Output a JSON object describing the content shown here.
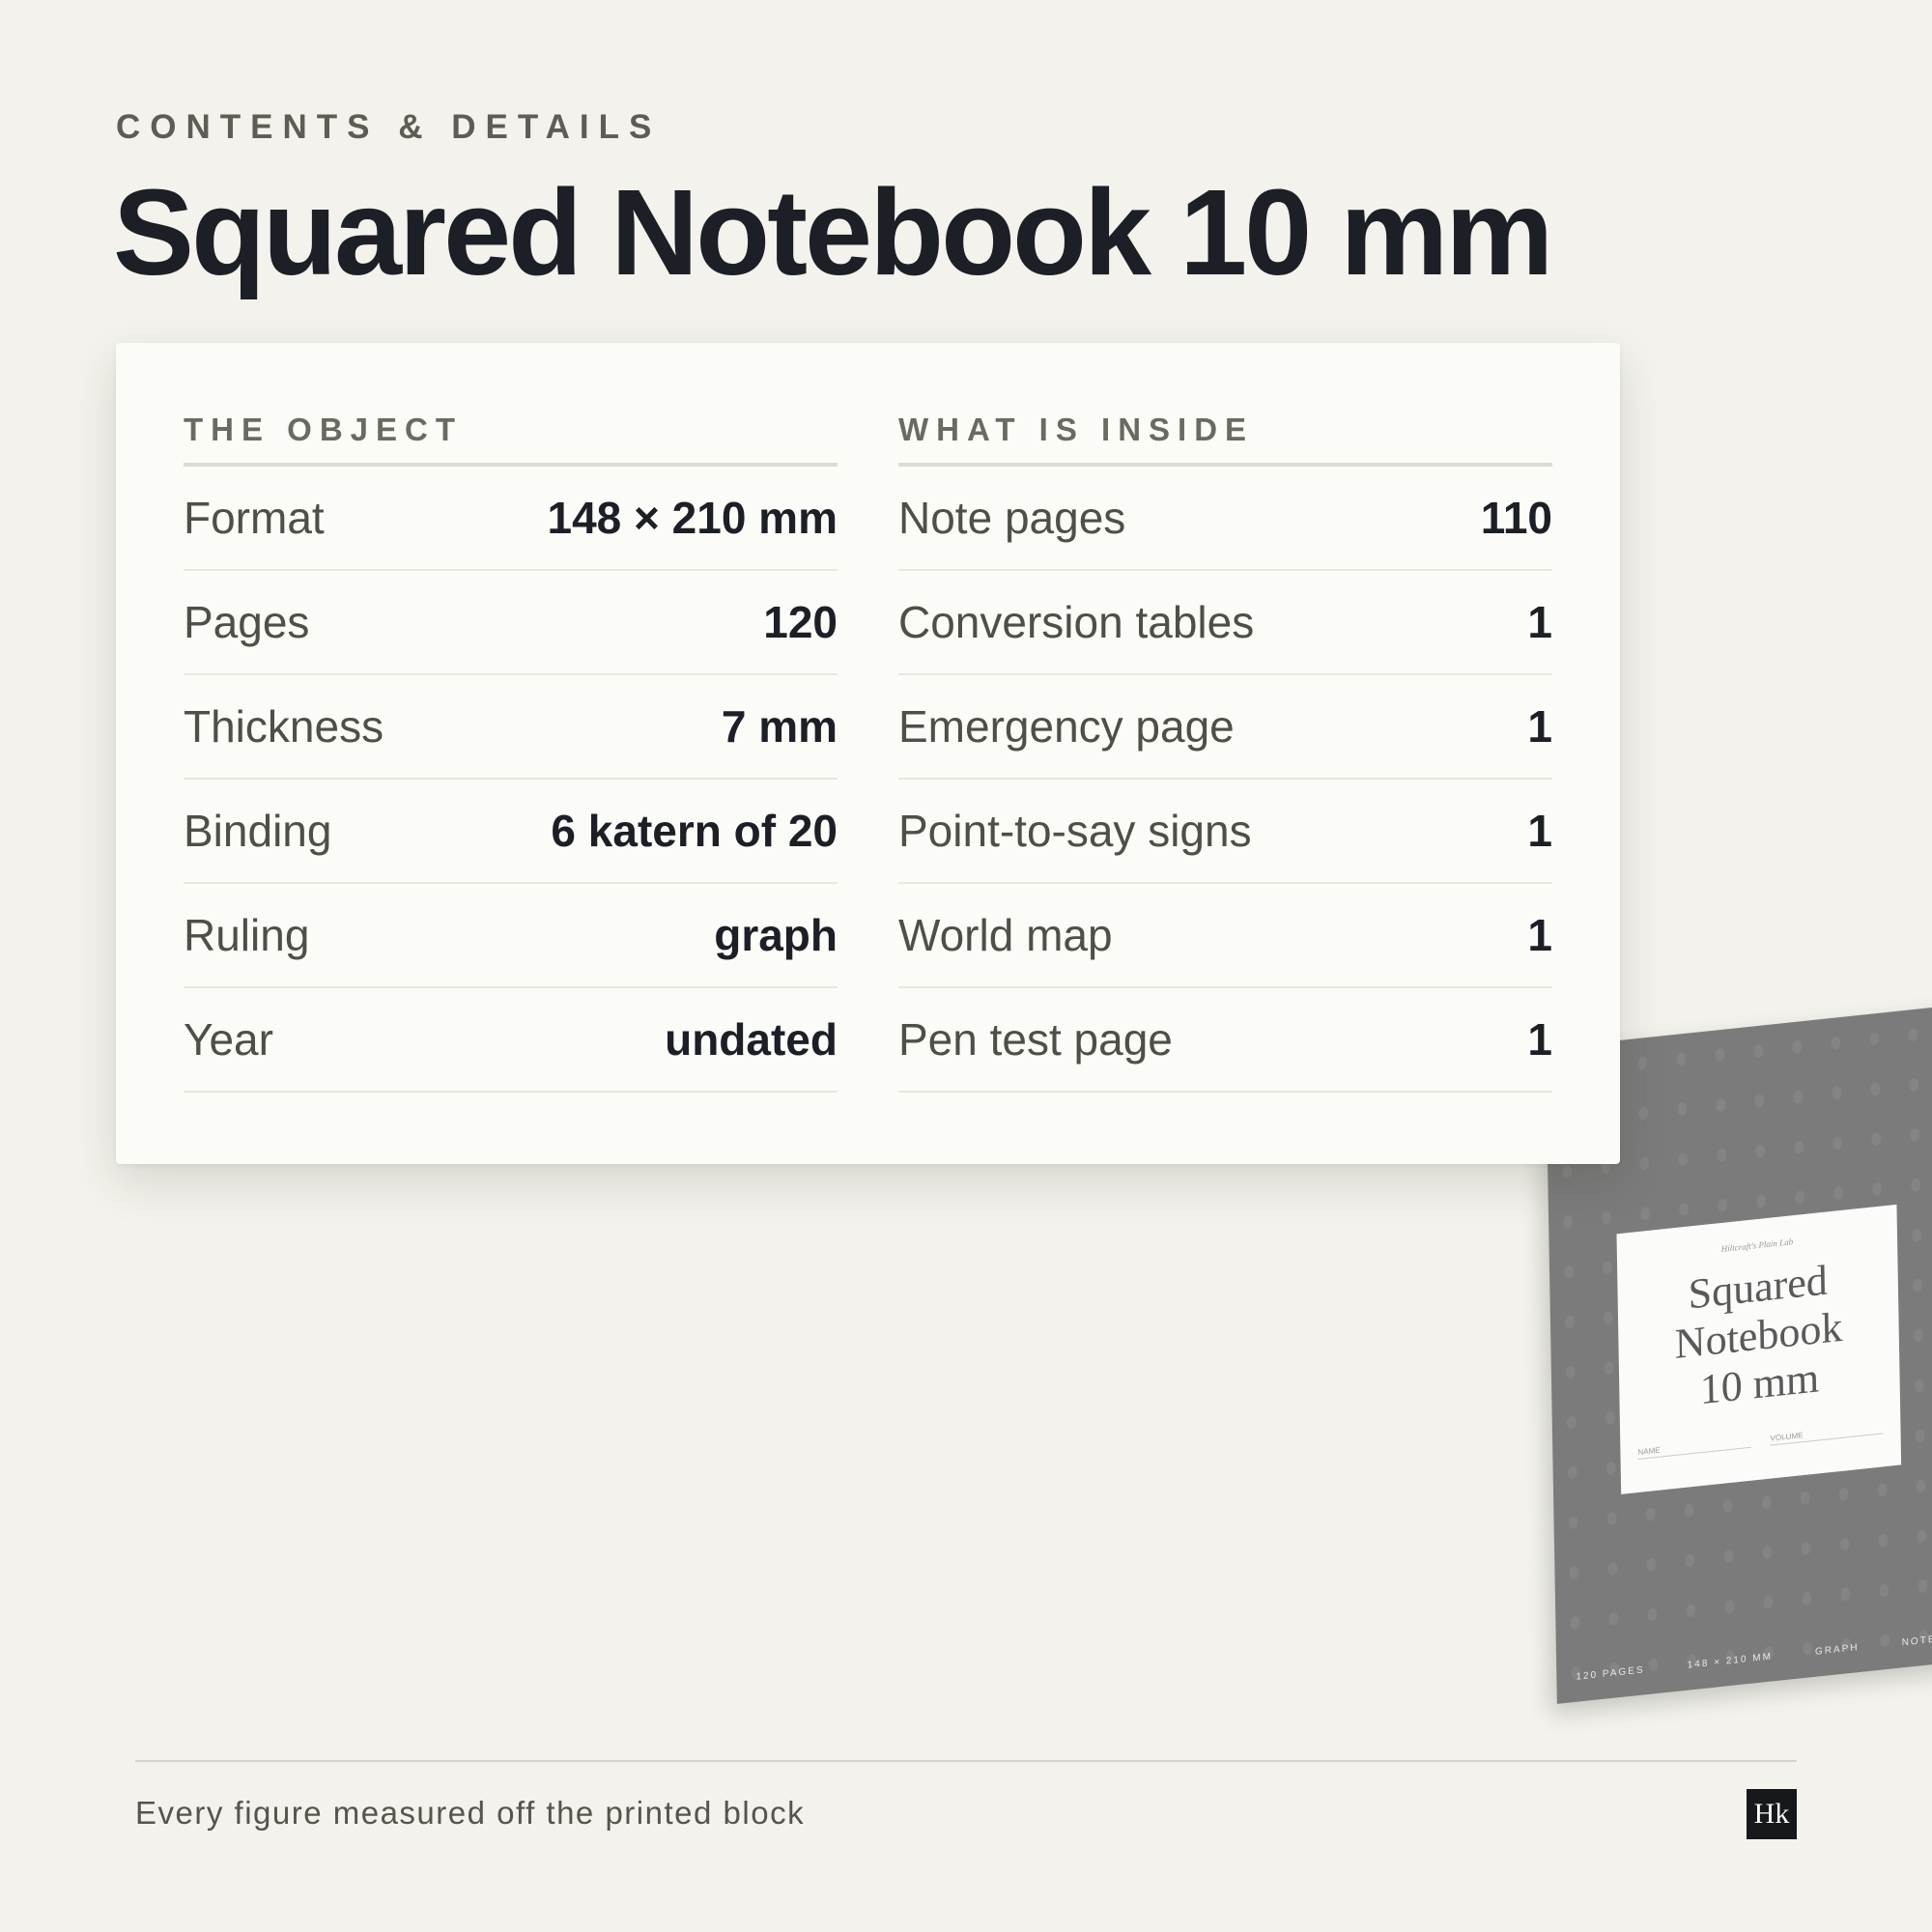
{
  "header": {
    "eyebrow": "CONTENTS & DETAILS",
    "title": "Squared Notebook 10 mm"
  },
  "object": {
    "heading": "THE OBJECT",
    "rows": [
      {
        "label": "Format",
        "value": "148 × 210 mm"
      },
      {
        "label": "Pages",
        "value": "120"
      },
      {
        "label": "Thickness",
        "value": "7 mm"
      },
      {
        "label": "Binding",
        "value": "6 katern of 20"
      },
      {
        "label": "Ruling",
        "value": "graph"
      },
      {
        "label": "Year",
        "value": "undated"
      }
    ]
  },
  "inside": {
    "heading": "WHAT IS INSIDE",
    "rows": [
      {
        "label": "Note pages",
        "value": "110"
      },
      {
        "label": "Conversion tables",
        "value": "1"
      },
      {
        "label": "Emergency page",
        "value": "1"
      },
      {
        "label": "Point-to-say signs",
        "value": "1"
      },
      {
        "label": "World map",
        "value": "1"
      },
      {
        "label": "Pen test page",
        "value": "1"
      }
    ]
  },
  "notebook": {
    "brand": "Hiltcraft's Plain Lab",
    "title_lines": [
      "Squared",
      "Notebook",
      "10 mm"
    ],
    "field_name": "NAME",
    "field_volume": "VOLUME",
    "spine": [
      "120 PAGES",
      "148 × 210 MM",
      "GRAPH",
      "NOTEBOOK"
    ]
  },
  "footer": {
    "caption": "Every figure measured off the printed block",
    "logo_text": "Hk"
  },
  "colors": {
    "background": "#f3f2ec",
    "card": "#fbfbf8",
    "ink": "#1c1f26",
    "muted": "#4f4e48",
    "notebook_cover": "#7b7b7b"
  }
}
